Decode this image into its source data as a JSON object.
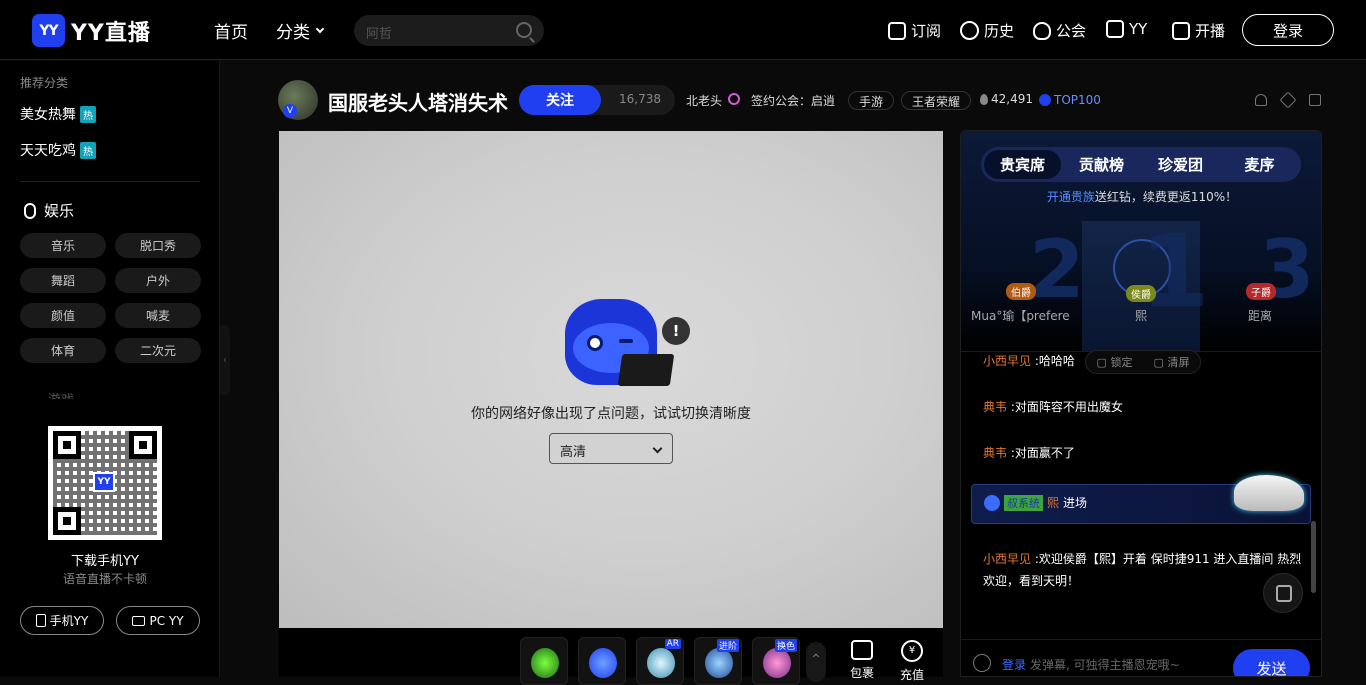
{
  "app": {
    "logo_mark": "YY",
    "logo_text": "YY直播"
  },
  "nav": {
    "home": "首页",
    "category": "分类"
  },
  "search": {
    "placeholder": "阿哲"
  },
  "topright": {
    "subscribe": "订阅",
    "history": "历史",
    "guild": "公会",
    "yy": "YY",
    "broadcast": "开播",
    "login": "登录"
  },
  "sidebar": {
    "recommend_title": "推荐分类",
    "hot_items": [
      {
        "label": "美女热舞",
        "tag": "热"
      },
      {
        "label": "天天吃鸡",
        "tag": "热"
      }
    ],
    "section_title": "娱乐",
    "chips": [
      "音乐",
      "脱口秀",
      "舞蹈",
      "户外",
      "颜值",
      "喊麦",
      "体育",
      "二次元"
    ],
    "partial_section": "游戏",
    "download_title": "下载手机YY",
    "download_sub": "语音直播不卡顿",
    "mobile_btn": "手机YY",
    "pc_btn": "PC YY"
  },
  "room": {
    "title": "国服老头人塔消失术",
    "follow_label": "关注",
    "followers": "16,738",
    "anchor": "北老头",
    "guild_label": "签约公会：启逍",
    "tags": [
      "手游",
      "王者荣耀"
    ],
    "heat": "42,491",
    "rank": "TOP100"
  },
  "player": {
    "error_text": "你的网络好像出现了点问题，试试切换清晰度",
    "quality_value": "高清"
  },
  "gifts": {
    "badges": [
      "AR",
      "进阶",
      "换色"
    ],
    "package_label": "包裹",
    "recharge_label": "充值"
  },
  "chat": {
    "tabs": [
      "贵宾席",
      "贡献榜",
      "珍爱团",
      "麦序"
    ],
    "vip_link": "开通贵族",
    "vip_text": "送红钻，续费更返110%！",
    "seats": [
      {
        "rank": "2",
        "badge": "伯爵",
        "name": "Mua°瑜【prefere…"
      },
      {
        "rank": "1",
        "badge": "侯爵",
        "name": "熙"
      },
      {
        "rank": "3",
        "badge": "子爵",
        "name": "距离"
      }
    ],
    "lock_label": "锁定",
    "clear_label": "清屏",
    "messages": [
      {
        "name": "小西早见",
        "text": "哈哈哈"
      },
      {
        "name": "典韦",
        "text": "对面阵容不用出魔女"
      },
      {
        "name": "典韦",
        "text": "对面赢不了"
      },
      {
        "name": "小西早见",
        "text": "欢迎侯爵【熙】开着 保时捷911 进入直播间 热烈欢迎，看到天明！"
      }
    ],
    "enter_tag": "叔系统",
    "enter_name": "熙",
    "enter_text": "进场",
    "input_login": "登录",
    "input_placeholder": "发弹幕, 可独得主播恩宠哦~",
    "send_label": "发送"
  },
  "colors": {
    "accent": "#1f3ff0",
    "name_orange": "#e0762a",
    "link_blue": "#5b8bff"
  }
}
